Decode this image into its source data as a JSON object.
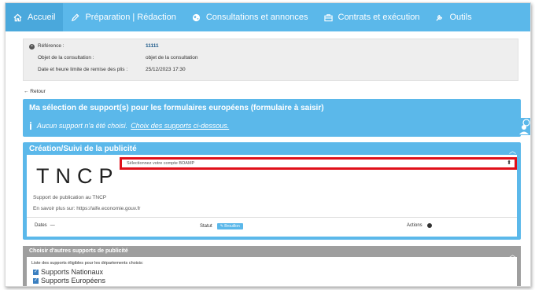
{
  "nav": {
    "items": [
      {
        "label": "Accueil",
        "icon": "home-icon"
      },
      {
        "label": "Préparation | Rédaction",
        "icon": "pencil-icon"
      },
      {
        "label": "Consultations et annonces",
        "icon": "globe-icon"
      },
      {
        "label": "Contrats et exécution",
        "icon": "briefcase-icon"
      },
      {
        "label": "Outils",
        "icon": "wrench-icon"
      }
    ]
  },
  "reference": {
    "reference_label": "Référence :",
    "reference_value": "11111",
    "objet_label": "Objet de la consultation :",
    "objet_value": "objet de la consultation",
    "date_label": "Date et heure limite de remise des plis :",
    "date_value": "25/12/2023 17:30"
  },
  "retour": "← Retour",
  "supports_panel": {
    "title": "Ma sélection de support(s) pour les formulaires européens (formulaire à saisir)",
    "message": "Aucun support n'a été choisi.",
    "link": "Choix des supports ci-dessous."
  },
  "publicite_panel": {
    "title": "Création/Suivi de la publicité",
    "logo_text": "TNCP",
    "select_placeholder": "Sélectionnez votre compte BOAMP",
    "description": "Support de publication au TNCP",
    "more_info": "En savoir plus sur: https://aife.economie.gouv.fr",
    "col_dates": "Dates",
    "col_statut": "Statut",
    "status_badge": "Brouillon",
    "col_actions": "Actions"
  },
  "autres_panel": {
    "title": "Choisir d'autres supports de publicité",
    "list_label": "Liste des supports éligibles pour les départements choisis:",
    "options": [
      {
        "label": "Supports Nationaux",
        "checked": true
      },
      {
        "label": "Supports Européens",
        "checked": true
      }
    ]
  },
  "colors": {
    "nav_bg": "#5bb8ea",
    "highlight_border": "#e0101a",
    "grey_panel": "#9e9e9e"
  }
}
